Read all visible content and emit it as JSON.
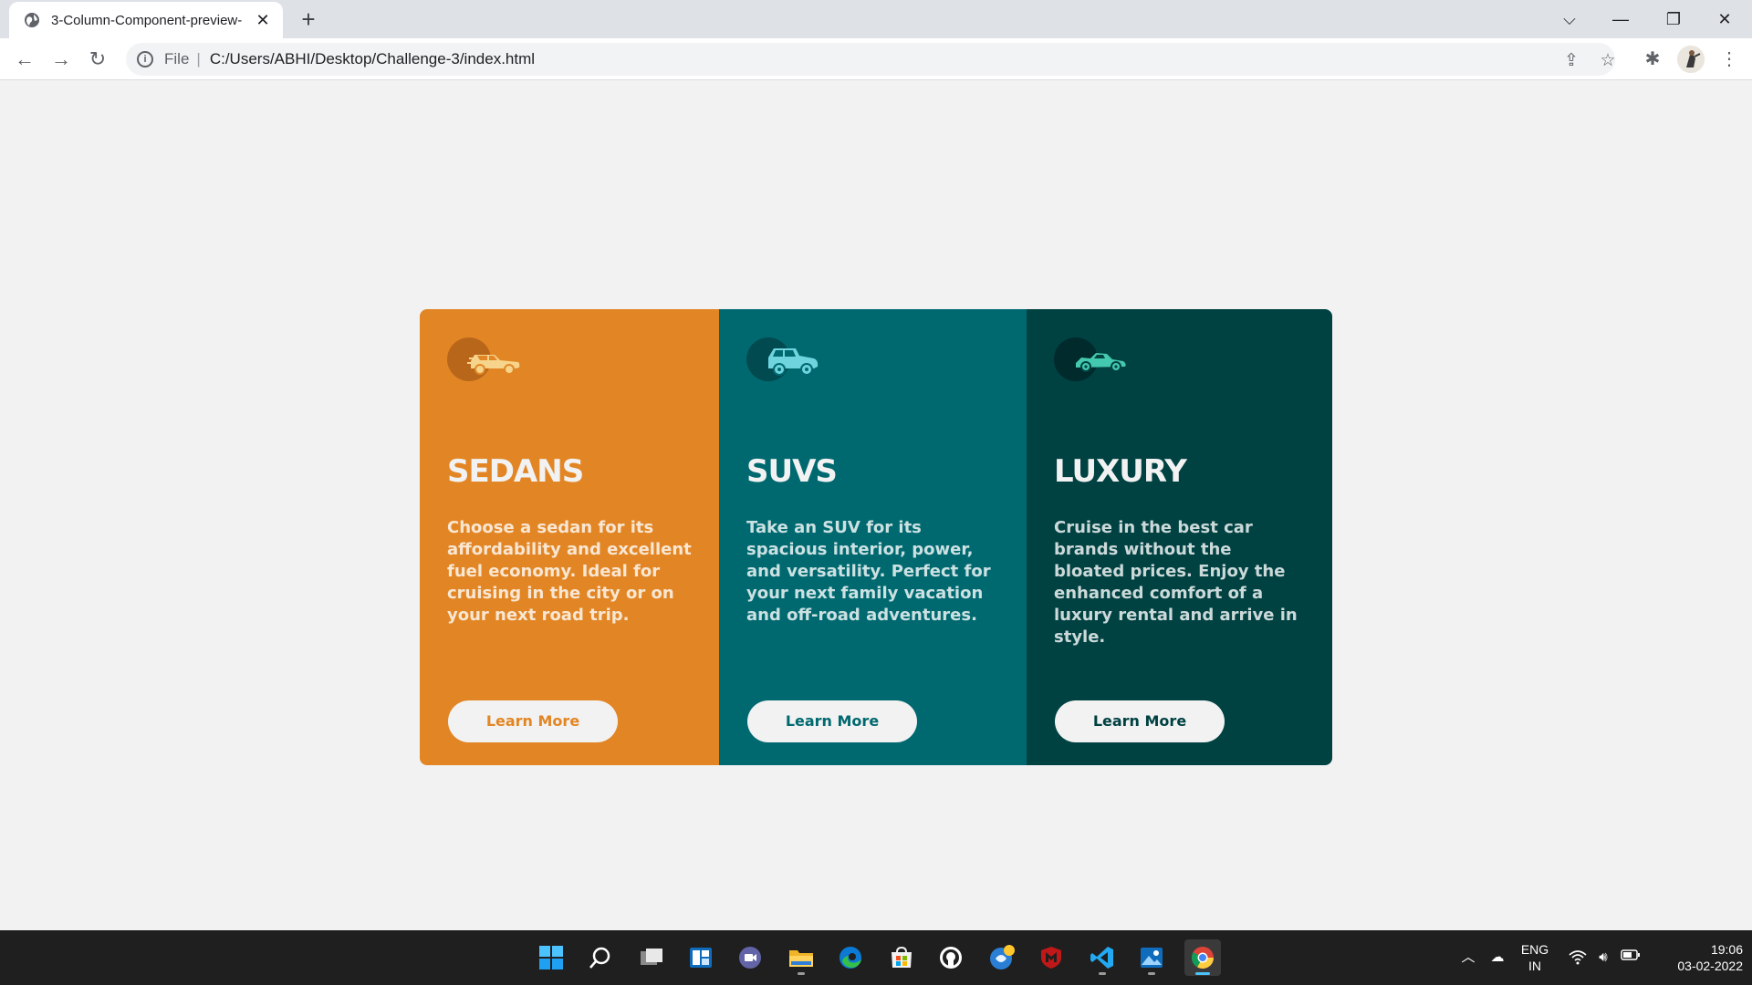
{
  "browser": {
    "tab_title": "3-Column-Component-preview-",
    "tab_close": "✕",
    "new_tab": "+",
    "scheme": "File",
    "separator": "|",
    "url": "C:/Users/ABHI/Desktop/Challenge-3/index.html"
  },
  "cards": [
    {
      "title": "SEDANS",
      "text": "Choose a sedan for its affordability and excellent fuel economy. Ideal for cruising in the city or on your next road trip.",
      "button": "Learn More",
      "bg": "#e28625",
      "accent": "#e28625",
      "icon": "sedan-car-icon"
    },
    {
      "title": "SUVS",
      "text": "Take an SUV for its spacious interior, power, and versatility. Perfect for your next family vacation and off-road adventures.",
      "button": "Learn More",
      "bg": "#006970",
      "accent": "#006970",
      "icon": "suv-car-icon"
    },
    {
      "title": "LUXURY",
      "text": "Cruise in the best car brands without the bloated prices. Enjoy the enhanced comfort of a luxury rental and arrive in style.",
      "button": "Learn More",
      "bg": "#004142",
      "accent": "#004142",
      "icon": "luxury-car-icon"
    }
  ],
  "taskbar": {
    "lang_1": "ENG",
    "lang_2": "IN",
    "time": "19:06",
    "date": "03-02-2022"
  }
}
